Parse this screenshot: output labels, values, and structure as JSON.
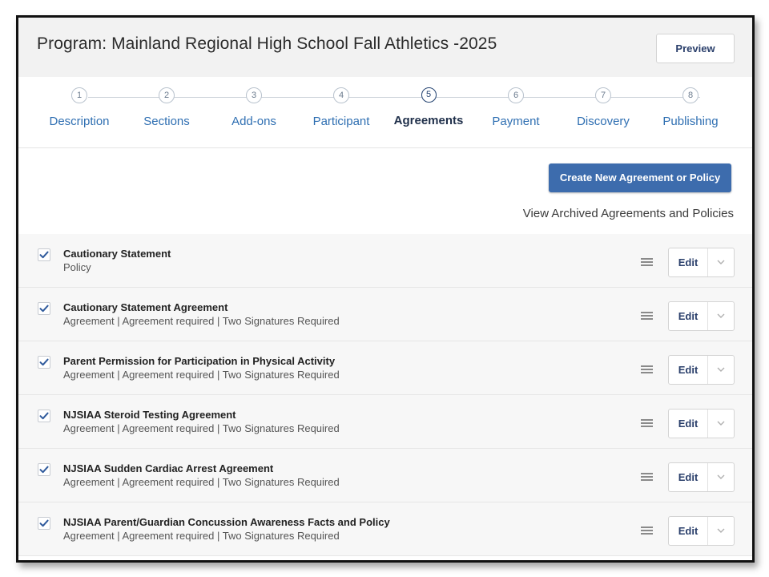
{
  "header": {
    "title": "Program: Mainland Regional High School Fall Athletics -2025",
    "preview_label": "Preview"
  },
  "steps": [
    {
      "num": "1",
      "label": "Description",
      "active": false
    },
    {
      "num": "2",
      "label": "Sections",
      "active": false
    },
    {
      "num": "3",
      "label": "Add-ons",
      "active": false
    },
    {
      "num": "4",
      "label": "Participant",
      "active": false
    },
    {
      "num": "5",
      "label": "Agreements",
      "active": true
    },
    {
      "num": "6",
      "label": "Payment",
      "active": false
    },
    {
      "num": "7",
      "label": "Discovery",
      "active": false
    },
    {
      "num": "8",
      "label": "Publishing",
      "active": false
    }
  ],
  "actions": {
    "create_label": "Create New Agreement or Policy",
    "archived_label": "View Archived Agreements and Policies"
  },
  "agreements": [
    {
      "title": "Cautionary Statement",
      "subtitle": "Policy",
      "checked": true,
      "edit_label": "Edit"
    },
    {
      "title": "Cautionary Statement Agreement",
      "subtitle": "Agreement | Agreement required | Two Signatures Required",
      "checked": true,
      "edit_label": "Edit"
    },
    {
      "title": "Parent Permission for Participation in Physical Activity",
      "subtitle": "Agreement | Agreement required | Two Signatures Required",
      "checked": true,
      "edit_label": "Edit"
    },
    {
      "title": "NJSIAA Steroid Testing Agreement",
      "subtitle": "Agreement | Agreement required | Two Signatures Required",
      "checked": true,
      "edit_label": "Edit"
    },
    {
      "title": "NJSIAA Sudden Cardiac Arrest Agreement",
      "subtitle": "Agreement | Agreement required | Two Signatures Required",
      "checked": true,
      "edit_label": "Edit"
    },
    {
      "title": "NJSIAA Parent/Guardian Concussion Awareness Facts and Policy",
      "subtitle": "Agreement | Agreement required | Two Signatures Required",
      "checked": true,
      "edit_label": "Edit"
    }
  ],
  "colors": {
    "accent": "#3d6cad",
    "step_link": "#2f6fb2",
    "checkmark": "#2f5a9c"
  },
  "icons": {
    "checkbox": "check-icon",
    "drag": "drag-handle-icon",
    "dropdown": "chevron-down-icon"
  }
}
